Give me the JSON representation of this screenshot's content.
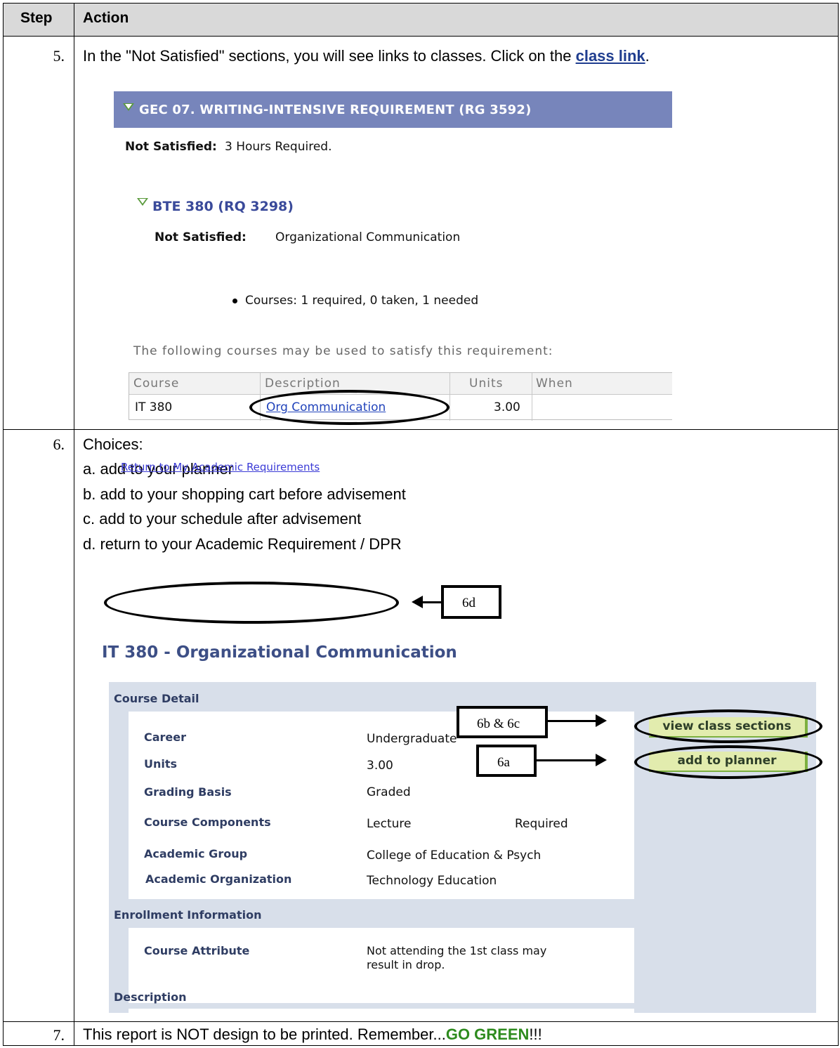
{
  "header": {
    "step": "Step",
    "action": "Action"
  },
  "step5": {
    "number": "5.",
    "text_before": "In the \"Not Satisfied\" sections, you will see links to classes.  Click on the ",
    "link": "class link",
    "text_after": ".",
    "screenshot": {
      "requirement_title": "GEC 07. WRITING-INTENSIVE REQUIREMENT (RG 3592)",
      "not_satisfied_label": "Not Satisfied:",
      "not_satisfied_value": "3 Hours Required.",
      "sub_title": "BTE 380 (RQ 3298)",
      "sub_not_satisfied_label": "Not Satisfied:",
      "sub_not_satisfied_value": "Organizational Communication",
      "courses_status": "Courses: 1 required, 0 taken, 1 needed",
      "note": "The following courses may be used to satisfy this requirement:",
      "table_headers": [
        "Course",
        "Description",
        "Units",
        "When"
      ],
      "row": {
        "course": "IT 380",
        "description": "Org Communication",
        "units": "3.00",
        "when": ""
      }
    }
  },
  "step6": {
    "number": "6.",
    "choices_label": "Choices:",
    "choices": [
      "a. add to your planner",
      "b. add to your shopping cart before advisement",
      "c. add to your schedule after advisement",
      "d. return to your Academic Requirement / DPR"
    ],
    "return_link": "Return to My Academic Requirements",
    "callouts": {
      "c6d": "6d",
      "c6bc": "6b & 6c",
      "c6a": "6a"
    },
    "course_title": "IT  380 - Organizational Communication",
    "course_detail_header": "Course Detail",
    "details": [
      {
        "label": "Career",
        "value": "Undergraduate"
      },
      {
        "label": "Units",
        "value": "3.00"
      },
      {
        "label": "Grading Basis",
        "value": "Graded"
      },
      {
        "label": "Course Components",
        "value": "Lecture",
        "extra": "Required"
      },
      {
        "label": "Academic Group",
        "value": "College of Education & Psych"
      },
      {
        "label": "Academic Organization",
        "value": "Technology Education"
      }
    ],
    "buttons": {
      "view_sections": "view class sections",
      "add_planner": "add to planner"
    },
    "enrollment_header": "Enrollment Information",
    "course_attribute_label": "Course Attribute",
    "course_attribute_line1": "Not attending the 1st class may",
    "course_attribute_line2": "result in drop.",
    "description_header": "Description"
  },
  "step7": {
    "number": "7.",
    "text": "This report is NOT design to be printed.  Remember...",
    "go_green": "GO GREEN",
    "exclaim": "!!!"
  },
  "colors": {
    "header_bg": "#d9d9d9",
    "requirement_bar": "#7785bb",
    "panel_bg": "#d8dfea",
    "button_bg": "#e2ecae",
    "go_green": "#2e8b1e"
  }
}
